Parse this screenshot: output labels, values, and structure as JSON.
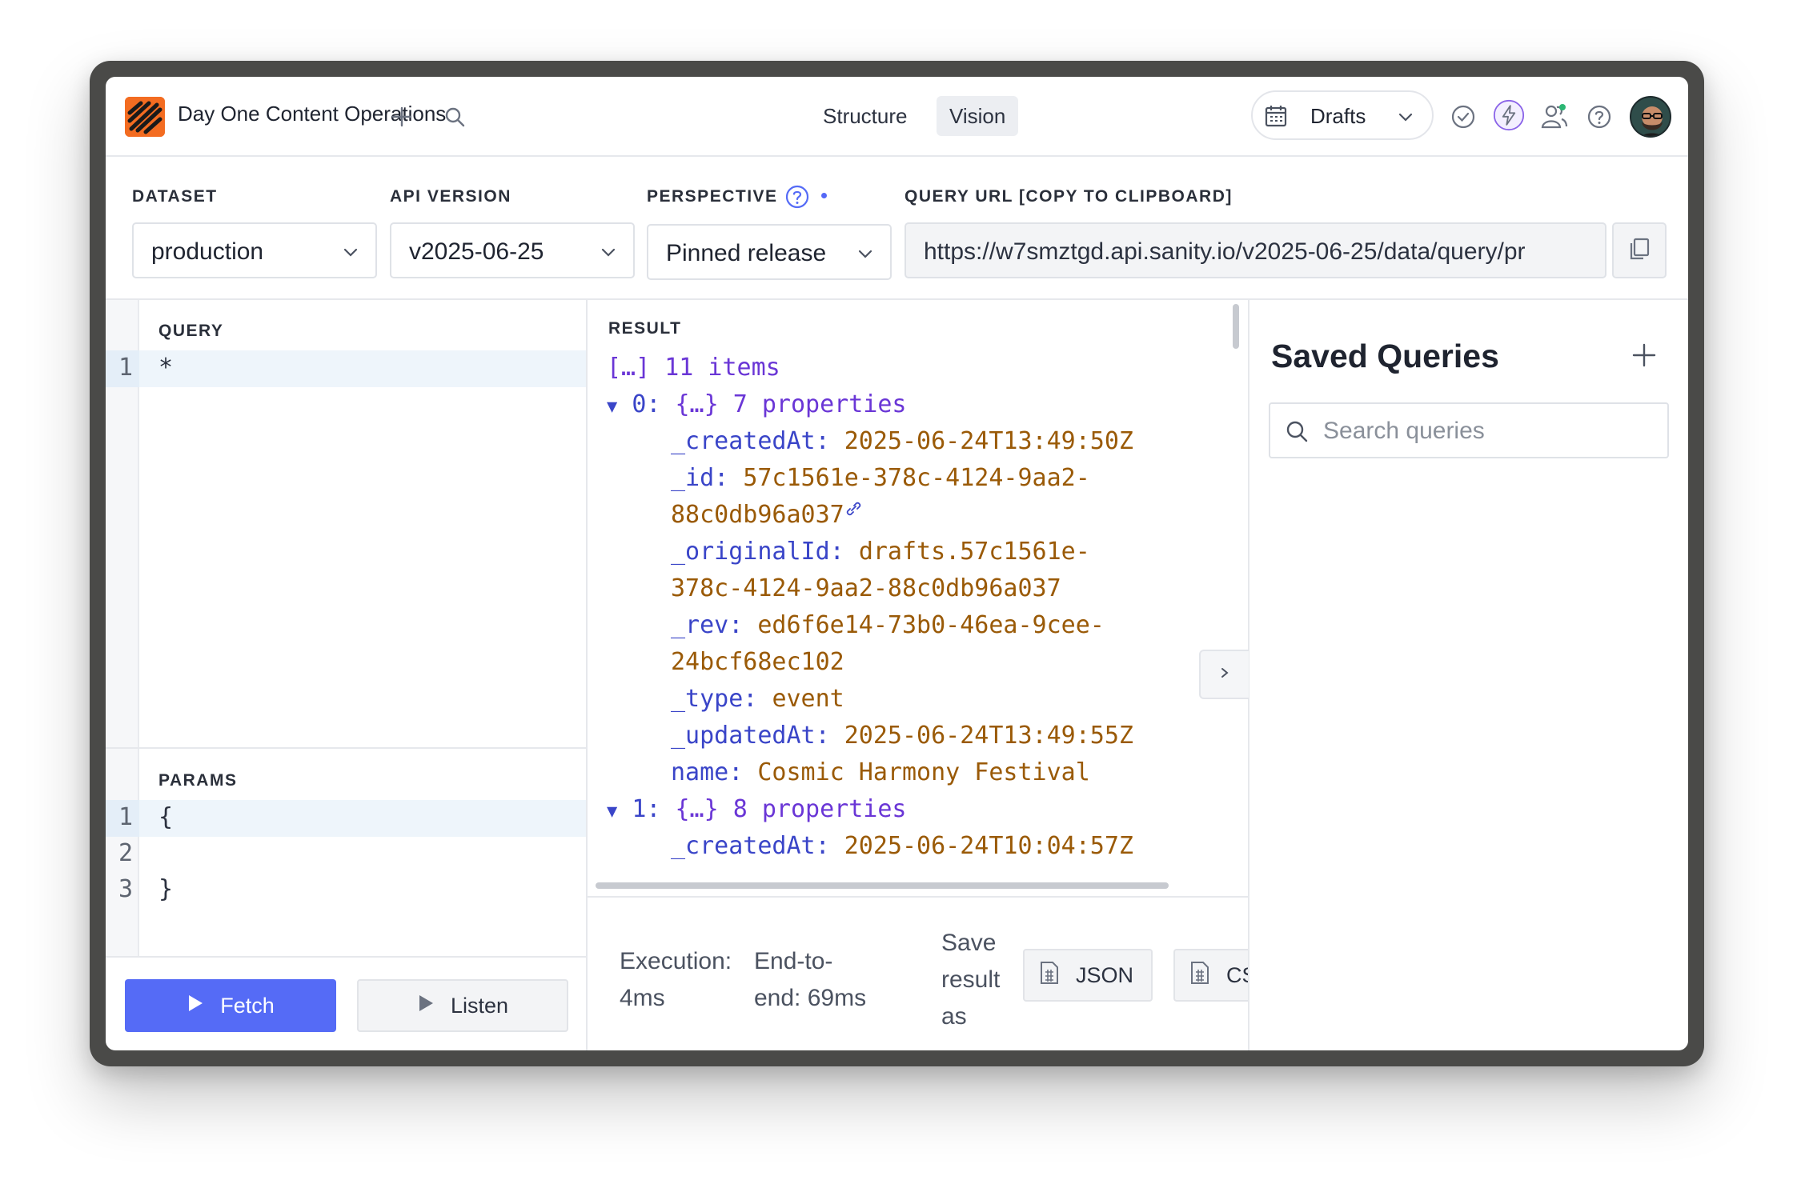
{
  "navbar": {
    "project_name": "Day One Content Operations",
    "tools": [
      "Structure",
      "Vision"
    ],
    "active_tool": "Vision",
    "perspective_label": "Drafts"
  },
  "params": {
    "dataset_label": "DATASET",
    "dataset_value": "production",
    "api_version_label": "API VERSION",
    "api_version_value": "v2025-06-25",
    "perspective_label": "PERSPECTIVE",
    "perspective_value": "Pinned release",
    "query_url_label": "QUERY URL [COPY TO CLIPBOARD]",
    "query_url_value": "https://w7smztgd.api.sanity.io/v2025-06-25/data/query/pr"
  },
  "query": {
    "title": "QUERY",
    "lines": [
      {
        "num": "1",
        "text": "*"
      }
    ]
  },
  "params_editor": {
    "title": "PARAMS",
    "lines": [
      {
        "num": "1",
        "text": "{"
      },
      {
        "num": "2",
        "text": ""
      },
      {
        "num": "3",
        "text": "}"
      }
    ]
  },
  "actions": {
    "fetch_label": "Fetch",
    "listen_label": "Listen"
  },
  "result": {
    "title": "RESULT",
    "summary": "[…] 11 items",
    "items": [
      {
        "header_index": "0:",
        "header_summary": "{…} 7 properties",
        "fields": [
          {
            "key": "_createdAt:",
            "value": "2025-06-24T13:49:50Z"
          },
          {
            "key": "_id:",
            "value": "57c1561e-378c-4124-9aa2-",
            "cont": "88c0db96a037"
          },
          {
            "key": "_originalId:",
            "value": "drafts.57c1561e-",
            "cont": "378c-4124-9aa2-88c0db96a037"
          },
          {
            "key": "_rev:",
            "value": "ed6f6e14-73b0-46ea-9cee-",
            "cont": "24bcf68ec102"
          },
          {
            "key": "_type:",
            "value": "event"
          },
          {
            "key": "_updatedAt:",
            "value": "2025-06-24T13:49:55Z"
          },
          {
            "key": "name:",
            "value": "Cosmic Harmony Festival"
          }
        ]
      },
      {
        "header_index": "1:",
        "header_summary": "{…} 8 properties",
        "fields": [
          {
            "key": "_createdAt:",
            "value": "2025-06-24T10:04:57Z"
          }
        ]
      }
    ]
  },
  "stats": {
    "execution_label": "Execution:",
    "execution_value": "4ms",
    "end_to_end_label": "End-to-",
    "end_to_end_value": "end: 69ms",
    "save_line1": "Save",
    "save_line2": "result",
    "save_line3": "as",
    "json_label": "JSON",
    "csv_label": "CSV"
  },
  "saved_queries": {
    "title": "Saved Queries",
    "search_placeholder": "Search queries"
  },
  "colors": {
    "accent": "#556bf6",
    "logo": "#f36c21",
    "json_key": "#3a45c8",
    "json_string": "#9a5a07",
    "json_meta": "#6a36d6"
  },
  "icons": [
    "plus-icon",
    "search-icon",
    "calendar-icon",
    "chevron-down-icon",
    "check-circle-icon",
    "bolt-icon",
    "users-icon",
    "help-icon",
    "copy-icon",
    "play-icon",
    "file-icon",
    "chevron-right-icon",
    "link-icon"
  ]
}
